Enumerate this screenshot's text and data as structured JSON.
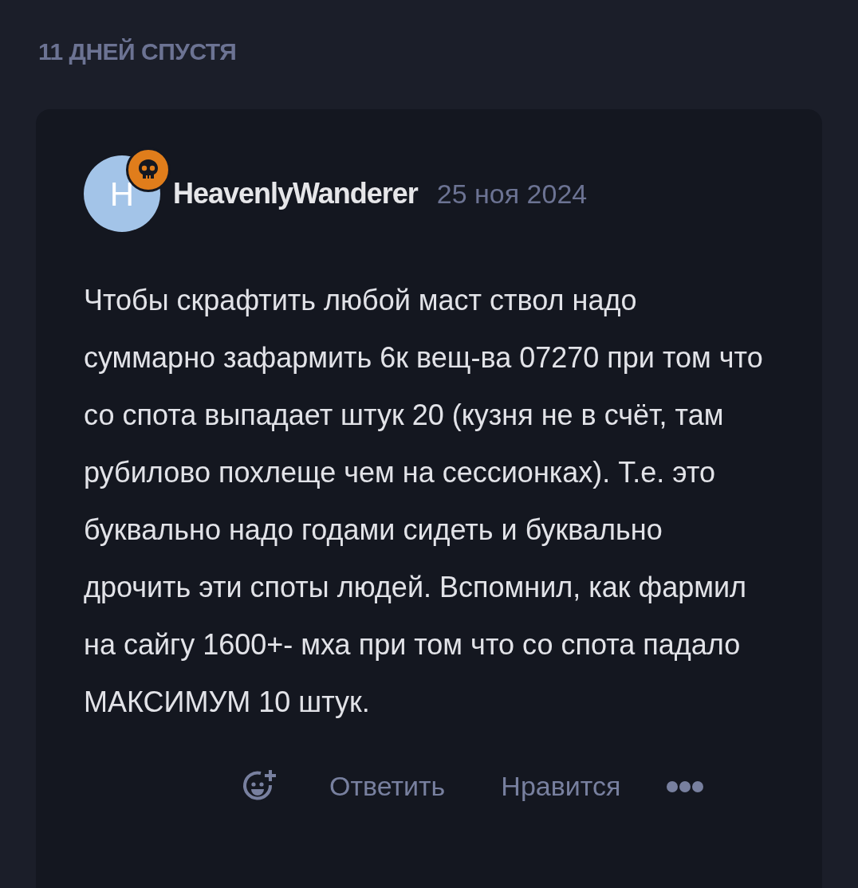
{
  "time_gap": "11 ДНЕЙ СПУСТЯ",
  "post": {
    "avatar_letter": "H",
    "username": "HeavenlyWanderer",
    "date": "25 ноя 2024",
    "body": "Чтобы скрафтить любой маст ствол надо суммарно зафармить 6к вещ-ва 07270 при том что со спота выпадает штук 20 (кузня не в счёт, там рубилово похлеще чем на сессионках). Т.е. это буквально надо годами сидеть и буквально дрочить эти споты людей. Вспомнил, как фармил на сайгу 1600+- мха при том что со спота падало МАКСИМУМ 10 штук.",
    "actions": [
      "Ответить",
      "Нравится"
    ]
  }
}
